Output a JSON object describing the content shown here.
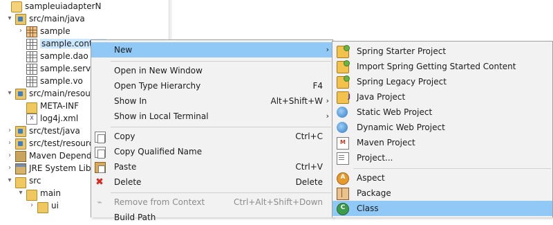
{
  "tree": {
    "items": [
      {
        "label": "sampleuiadapterN",
        "arrow": "▾",
        "icon": "project-icon"
      },
      {
        "label": "src/main/java",
        "arrow": "▾",
        "icon": "source-folder-icon"
      },
      {
        "label": "sample",
        "arrow": "›",
        "icon": "package-icon"
      },
      {
        "label": "sample.controll",
        "arrow": "",
        "icon": "package-icon"
      },
      {
        "label": "sample.dao",
        "arrow": "",
        "icon": "package-icon"
      },
      {
        "label": "sample.servic",
        "arrow": "",
        "icon": "package-icon"
      },
      {
        "label": "sample.vo",
        "arrow": "",
        "icon": "package-icon"
      },
      {
        "label": "src/main/resour",
        "arrow": "▾",
        "icon": "source-folder-icon"
      },
      {
        "label": "META-INF",
        "arrow": "",
        "icon": "folder-icon"
      },
      {
        "label": "log4j.xml",
        "arrow": "",
        "icon": "xml-file-icon"
      },
      {
        "label": "src/test/java",
        "arrow": "›",
        "icon": "source-folder-icon"
      },
      {
        "label": "src/test/resource",
        "arrow": "›",
        "icon": "source-folder-icon"
      },
      {
        "label": "Maven Depende",
        "arrow": "›",
        "icon": "library-icon"
      },
      {
        "label": "JRE System Libra",
        "arrow": "›",
        "icon": "jre-library-icon"
      },
      {
        "label": "src",
        "arrow": "▾",
        "icon": "folder-icon"
      },
      {
        "label": "main",
        "arrow": "▾",
        "icon": "folder-icon"
      },
      {
        "label": "ui",
        "arrow": "›",
        "icon": "folder-icon"
      }
    ]
  },
  "context_menu": {
    "new": {
      "label": "New",
      "submenu": "›"
    },
    "open_new_window": {
      "label": "Open in New Window"
    },
    "open_type_hierarchy": {
      "label": "Open Type Hierarchy",
      "shortcut": "F4"
    },
    "show_in": {
      "label": "Show In",
      "shortcut": "Alt+Shift+W",
      "submenu": "›"
    },
    "show_in_terminal": {
      "label": "Show in Local Terminal",
      "submenu": "›"
    },
    "copy": {
      "label": "Copy",
      "shortcut": "Ctrl+C"
    },
    "copy_qualified": {
      "label": "Copy Qualified Name"
    },
    "paste": {
      "label": "Paste",
      "shortcut": "Ctrl+V"
    },
    "delete": {
      "label": "Delete",
      "shortcut": "Delete"
    },
    "remove_context": {
      "label": "Remove from Context",
      "shortcut": "Ctrl+Alt+Shift+Down"
    },
    "build_path": {
      "label": "Build Path"
    }
  },
  "new_submenu": {
    "items": [
      {
        "label": "Spring Starter Project"
      },
      {
        "label": "Import Spring Getting Started Content"
      },
      {
        "label": "Spring Legacy Project"
      },
      {
        "label": "Java Project"
      },
      {
        "label": "Static Web Project"
      },
      {
        "label": "Dynamic Web Project"
      },
      {
        "label": "Maven Project"
      },
      {
        "label": "Project..."
      },
      {
        "label": "Aspect"
      },
      {
        "label": "Package"
      },
      {
        "label": "Class"
      }
    ]
  },
  "colors": {
    "highlight": "#90c8f6",
    "selection": "#cce8ff",
    "menu_bg": "#f2f2f2"
  }
}
